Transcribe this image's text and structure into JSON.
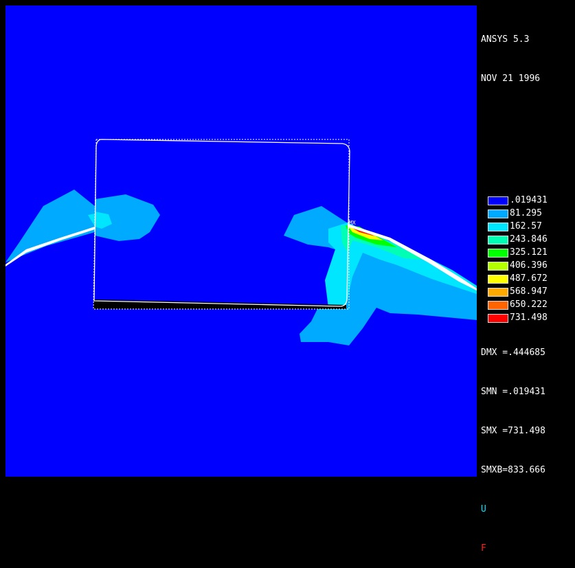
{
  "header": {
    "program": "ANSYS 5.3",
    "date": "NOV 21 1996"
  },
  "info_lines_obscured": [
    "",
    "",
    "",
    "",
    "",
    ""
  ],
  "stats": {
    "dmx": "DMX =.444685",
    "smn": "SMN =.019431",
    "smx": "SMX =731.498",
    "smxb": "SMXB=833.666"
  },
  "symbols": {
    "u": "U",
    "f": "F"
  },
  "legend": {
    "levels": [
      {
        "value": ".019431",
        "color": "#0000ff"
      },
      {
        "value": "81.295",
        "color": "#00aaff"
      },
      {
        "value": "162.57",
        "color": "#00e6ff"
      },
      {
        "value": "243.846",
        "color": "#00ffb4"
      },
      {
        "value": "325.121",
        "color": "#00ff00"
      },
      {
        "value": "406.396",
        "color": "#b4ff00"
      },
      {
        "value": "487.672",
        "color": "#ffff00"
      },
      {
        "value": "568.947",
        "color": "#ffaa00"
      },
      {
        "value": "650.222",
        "color": "#ff6400"
      },
      {
        "value": "731.498",
        "color": "#ff0000"
      }
    ]
  },
  "plot": {
    "mx_marker": "MX"
  }
}
